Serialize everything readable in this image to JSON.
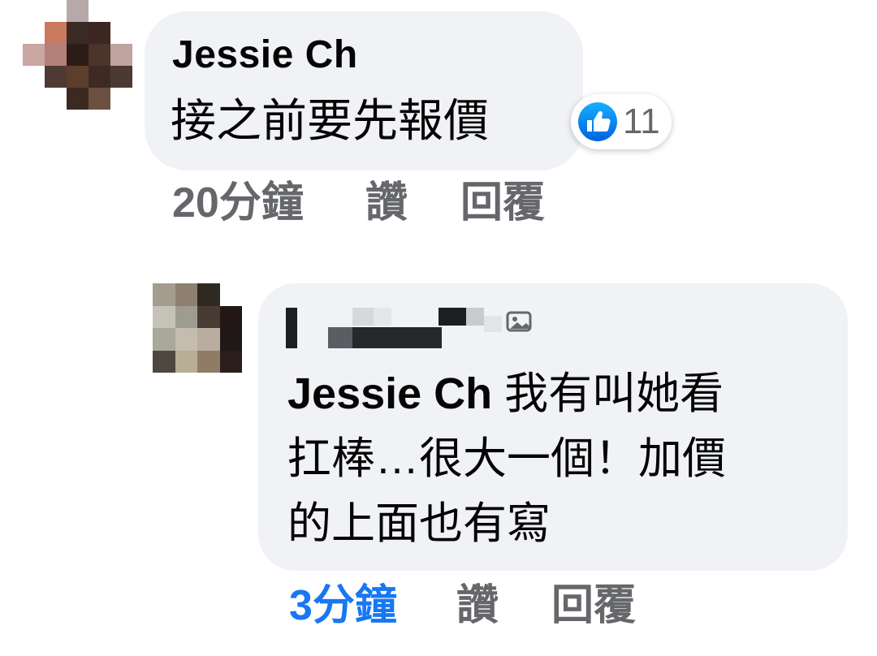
{
  "colors": {
    "bubble_bg": "#f0f2f5",
    "meta_gray": "#65676b",
    "link_blue": "#1877f2",
    "like_blue": "#1877f2"
  },
  "comment": {
    "author": "Jessie Ch",
    "text": "接之前要先報價",
    "reaction": {
      "icon": "thumbs-up-icon",
      "count": "11"
    },
    "actions": {
      "time": "20分鐘",
      "like": "讚",
      "reply": "回覆"
    }
  },
  "reply": {
    "author_redacted": true,
    "edited_icon": "photo-icon",
    "mention": "Jessie Ch",
    "text_line1": " 我有叫她看",
    "text_line2": "扛棒…很大一個！加價",
    "text_line3": "的上面也有寫",
    "actions": {
      "time": "3分鐘",
      "like": "讚",
      "reply": "回覆"
    }
  }
}
